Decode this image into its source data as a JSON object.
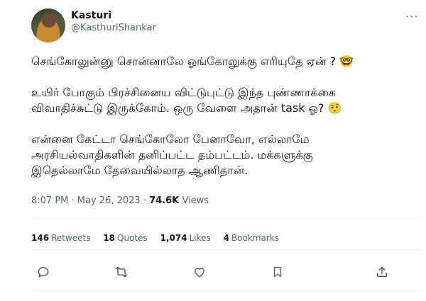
{
  "author": {
    "name": "Kasturi",
    "handle": "@KasthuriShankar"
  },
  "tweet": {
    "paragraphs": [
      "செங்கோலுன்னு சொன்னாலே ஓங்கோலுக்கு எரியுதே ஏன் ? 🤓",
      " உயிர் போகும் பிரச்சினைய விட்டுபுட்டு இந்த புண்ணாக்கை\nவிவாதிச்சுட்டு இருக்கோம். ஒரு வேளை அதான் task ஓ? 🤨",
      "என்னை கேட்டா செங்கோலோ பேனாவோ,  எல்லாமே\nஅரசியல்வாதிகளின் தனிப்பட்ட தம்பட்டம். மக்களுக்கு\nஇதெல்லாமே தேவையில்லாத ஆணிதான்."
    ],
    "time_date": "8:07 PM · May 26, 2023 · ",
    "views_count": "74.6K",
    "views_label": " Views"
  },
  "stats": {
    "retweets": "146",
    "retweets_label": "Retweets",
    "quotes": "18",
    "quotes_label": "Quotes",
    "likes": "1,074",
    "likes_label": "Likes",
    "bookmarks": "4",
    "bookmarks_label": "Bookmarks"
  },
  "more_label": "···",
  "icons": [
    "reply-icon",
    "retweet-icon",
    "like-icon",
    "bookmark-icon",
    "share-icon"
  ],
  "colors": {
    "text": "#0f1419",
    "muted": "#536471",
    "divider": "#eff3f4"
  }
}
